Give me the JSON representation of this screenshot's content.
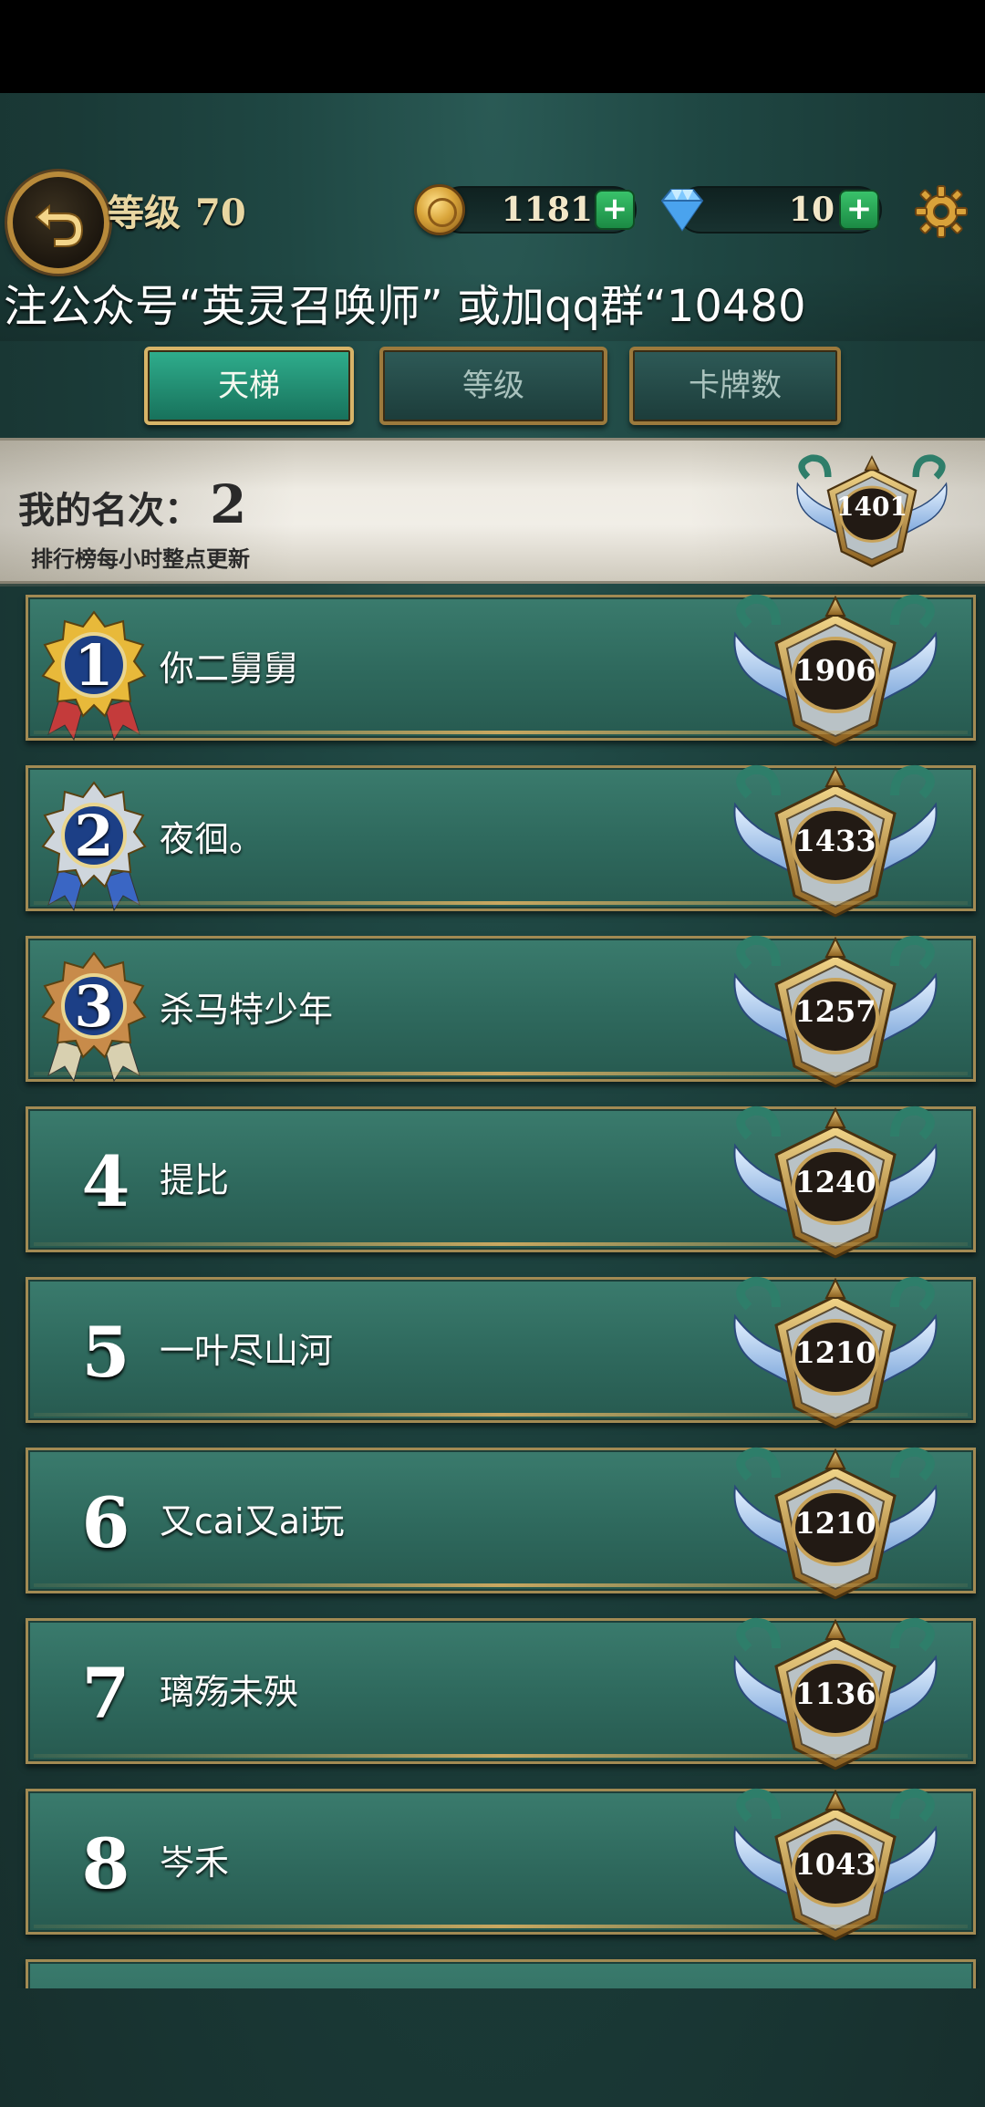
{
  "header": {
    "level_label": "等级",
    "level_value": "70",
    "coins": "1181",
    "gems": "10",
    "plus": "+"
  },
  "marquee": "注公众号“英灵召唤师” 或加qq群“10480",
  "tabs": [
    {
      "label": "天梯",
      "active": true
    },
    {
      "label": "等级",
      "active": false
    },
    {
      "label": "卡牌数",
      "active": false
    }
  ],
  "my_rank": {
    "label": "我的名次：",
    "rank": "2",
    "note": "排行榜每小时整点更新",
    "score": "1401"
  },
  "rankings": [
    {
      "rank": "1",
      "name": "你二舅舅",
      "score": "1906"
    },
    {
      "rank": "2",
      "name": "夜徊。",
      "score": "1433"
    },
    {
      "rank": "3",
      "name": "杀马特少年",
      "score": "1257"
    },
    {
      "rank": "4",
      "name": "提比",
      "score": "1240"
    },
    {
      "rank": "5",
      "name": "一叶尽山河",
      "score": "1210"
    },
    {
      "rank": "6",
      "name": "又cai又ai玩",
      "score": "1210"
    },
    {
      "rank": "7",
      "name": "璃殇未殃",
      "score": "1136"
    },
    {
      "rank": "8",
      "name": "岑禾",
      "score": "1043"
    }
  ],
  "colors": {
    "gold_medal": "#e8b93a",
    "silver_medal": "#cfd6dd",
    "bronze_medal": "#c88b4a",
    "active_tab": "#2fae8d"
  },
  "icons": {
    "back": "back-arrow-icon",
    "coin": "coin-icon",
    "gem": "diamond-icon",
    "settings": "gear-icon"
  }
}
